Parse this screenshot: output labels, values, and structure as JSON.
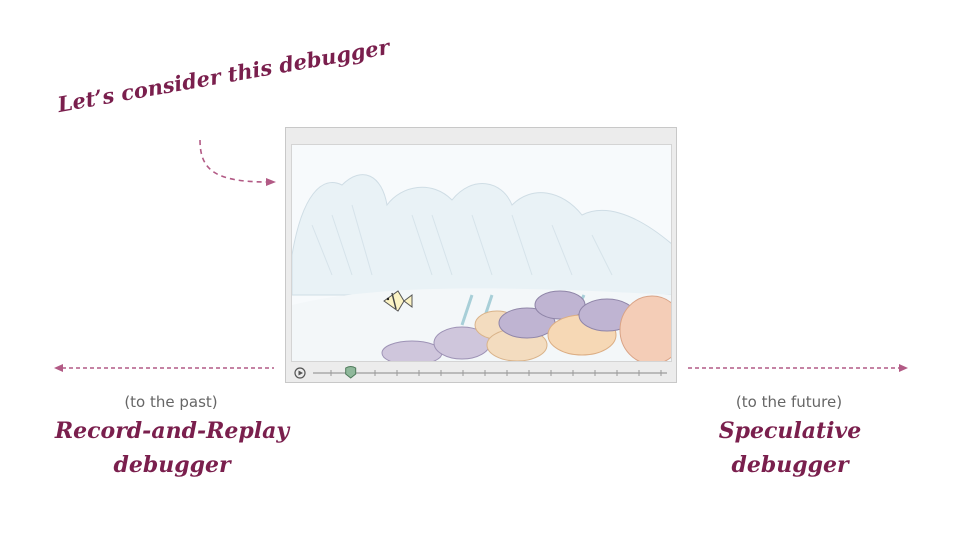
{
  "callout": {
    "text": "Let’s consider this debugger"
  },
  "left": {
    "direction": "(to the past)",
    "title_line1": "Record-and-Replay",
    "title_line2": "debugger"
  },
  "right": {
    "direction": "(to the future)",
    "title_line1": "Speculative",
    "title_line2": "debugger"
  },
  "colors": {
    "accent": "#7a1f4d",
    "arrow": "#b25a85",
    "muted": "#666666"
  },
  "player": {
    "play_icon": "play-icon",
    "progress": 0.05
  }
}
